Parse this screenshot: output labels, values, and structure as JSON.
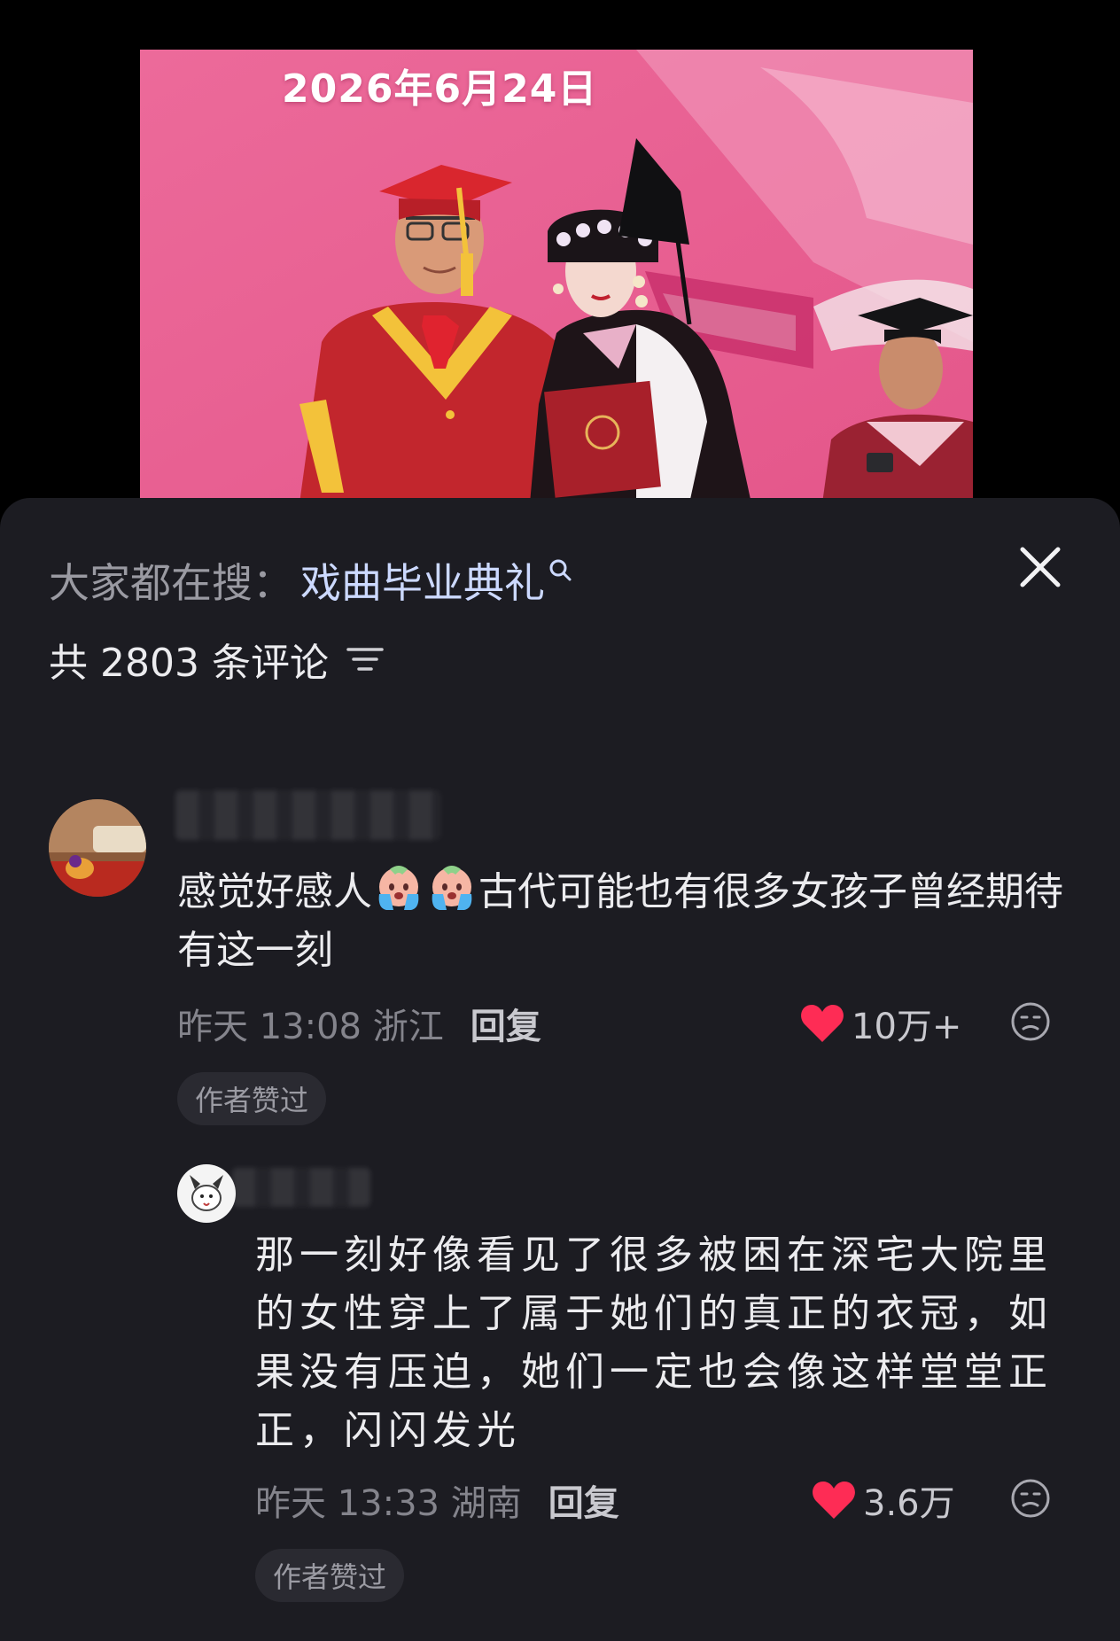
{
  "video": {
    "date_overlay": "2026年6月24日"
  },
  "panel": {
    "search_prefix": "大家都在搜：",
    "search_term": "戏曲毕业典礼",
    "comment_count": "共 2803 条评论",
    "icons": {
      "close": "close-icon",
      "filter": "sort-filter-icon",
      "search": "search-icon"
    }
  },
  "comments": [
    {
      "text_before": "感觉好感人",
      "emoji": "crying-face-emoji",
      "text_after": "古代可能也有很多女孩子曾经期待有这一刻",
      "time_location": "昨天 13:08 浙江",
      "reply_label": "回复",
      "likes": "10万+",
      "badge": "作者赞过"
    },
    {
      "text": "那一刻好像看见了很多被困在深宅大院里的女性穿上了属于她们的真正的衣冠，如果没有压迫，她们一定也会像这样堂堂正正，闪闪发光",
      "time_location": "昨天 13:33 湖南",
      "reply_label": "回复",
      "likes": "3.6万",
      "badge": "作者赞过"
    }
  ],
  "colors": {
    "panel_bg": "#1c1c22",
    "like_red": "#fe2c55",
    "search_term": "#ccd9ff"
  }
}
